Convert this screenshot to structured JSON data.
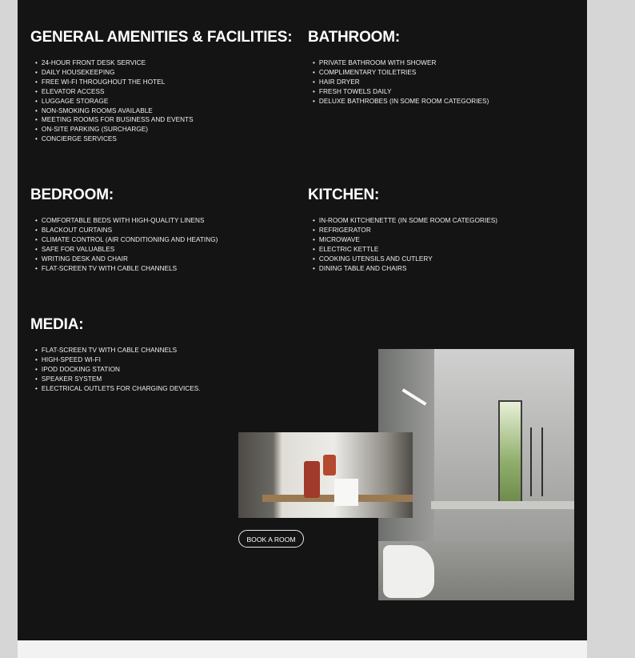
{
  "sections": {
    "general": {
      "title": "GENERAL AMENITIES & FACILITIES:",
      "items": [
        "24-HOUR FRONT DESK SERVICE",
        "DAILY HOUSEKEEPING",
        "FREE WI-FI THROUGHOUT THE HOTEL",
        "ELEVATOR ACCESS",
        "LUGGAGE STORAGE",
        "NON-SMOKING ROOMS AVAILABLE",
        "MEETING ROOMS FOR BUSINESS AND EVENTS",
        "ON-SITE PARKING (SURCHARGE)",
        "CONCIERGE SERVICES"
      ]
    },
    "bathroom": {
      "title": "BATHROOM:",
      "items": [
        "PRIVATE BATHROOM WITH SHOWER",
        "COMPLIMENTARY TOILETRIES",
        "HAIR DRYER",
        "FRESH TOWELS DAILY",
        "DELUXE BATHROBES (IN SOME ROOM CATEGORIES)"
      ]
    },
    "bedroom": {
      "title": "BEDROOM:",
      "items": [
        "COMFORTABLE BEDS WITH HIGH-QUALITY LINENS",
        "BLACKOUT CURTAINS",
        "CLIMATE CONTROL (AIR CONDITIONING AND HEATING)",
        "SAFE FOR VALUABLES",
        "WRITING DESK AND CHAIR",
        "FLAT-SCREEN TV WITH CABLE CHANNELS"
      ]
    },
    "kitchen": {
      "title": "KITCHEN:",
      "items": [
        "IN-ROOM KITCHENETTE (IN SOME ROOM CATEGORIES)",
        "REFRIGERATOR",
        "MICROWAVE",
        "ELECTRIC KETTLE",
        "COOKING UTENSILS AND CUTLERY",
        "DINING TABLE AND CHAIRS"
      ]
    },
    "media": {
      "title": "MEDIA:",
      "items": [
        "FLAT-SCREEN TV WITH CABLE CHANNELS",
        "HIGH-SPEED WI-FI",
        "IPOD DOCKING STATION",
        "SPEAKER SYSTEM",
        "ELECTRICAL OUTLETS FOR CHARGING DEVICES."
      ]
    }
  },
  "cta": {
    "book_label": "BOOK A ROOM"
  },
  "colors": {
    "panel_bg": "#141414",
    "page_bg": "#d6d6d6",
    "text": "#ffffff"
  }
}
